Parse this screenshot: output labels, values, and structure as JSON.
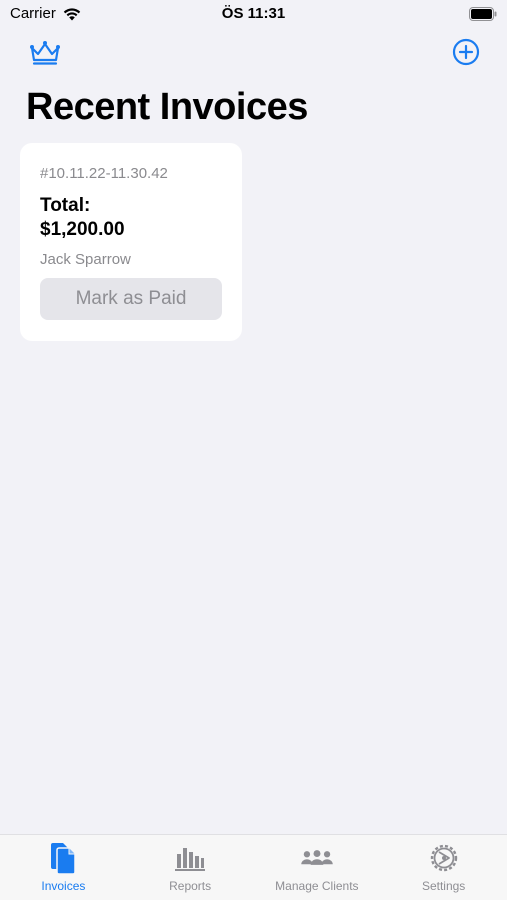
{
  "status_bar": {
    "carrier": "Carrier",
    "time": "ÖS 11:31"
  },
  "nav": {
    "crown_icon": "crown-icon",
    "add_icon": "plus-circle-icon"
  },
  "page": {
    "title": "Recent Invoices"
  },
  "invoices": [
    {
      "number": "#10.11.22-11.30.42",
      "total_label": "Total:",
      "total_amount": "$1,200.00",
      "client": "Jack Sparrow",
      "action_label": "Mark as Paid"
    }
  ],
  "tabs": [
    {
      "label": "Invoices",
      "icon": "documents-icon",
      "active": true
    },
    {
      "label": "Reports",
      "icon": "bar-chart-icon",
      "active": false
    },
    {
      "label": "Manage Clients",
      "icon": "people-icon",
      "active": false
    },
    {
      "label": "Settings",
      "icon": "gear-icon",
      "active": false
    }
  ],
  "colors": {
    "accent": "#1a7cf0",
    "background": "#f2f2f7",
    "inactive": "#8e8e93"
  }
}
